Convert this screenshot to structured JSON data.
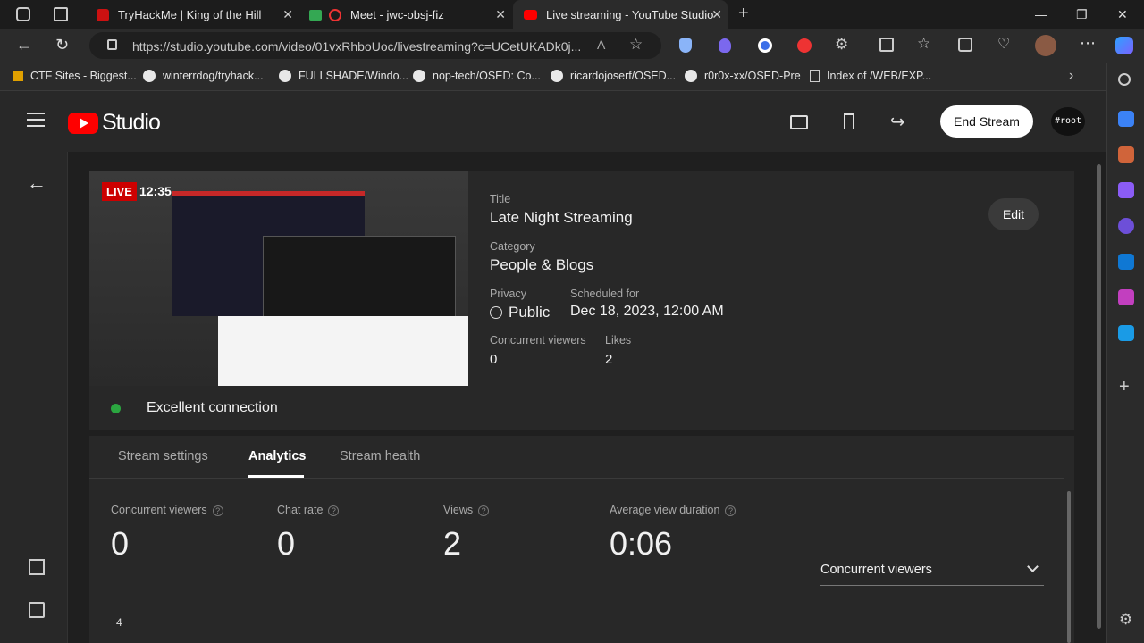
{
  "browser": {
    "tabs": [
      {
        "title": "TryHackMe | King of the Hill",
        "active": false
      },
      {
        "title": "Meet - jwc-obsj-fiz",
        "active": false
      },
      {
        "title": "Live streaming - YouTube Studio",
        "active": true
      }
    ],
    "url": "https://studio.youtube.com/video/01vxRhboUoc/livestreaming?c=UCetUKADk0j...",
    "bookmarks": [
      "CTF Sites - Biggest...",
      "winterrdog/tryhack...",
      "FULLSHADE/Windo...",
      "nop-tech/OSED: Co...",
      "ricardojoserf/OSED...",
      "r0r0x-xx/OSED-Pre",
      "Index of /WEB/EXP..."
    ]
  },
  "studio": {
    "logo_text": "Studio",
    "end_stream_label": "End Stream",
    "avatar_text": "#root",
    "live_badge": "LIVE",
    "live_time": "12:35",
    "connection_status": "Excellent connection",
    "details": {
      "title_label": "Title",
      "title": "Late Night Streaming",
      "category_label": "Category",
      "category": "People & Blogs",
      "privacy_label": "Privacy",
      "privacy": "Public",
      "scheduled_label": "Scheduled for",
      "scheduled": "Dec 18, 2023, 12:00 AM",
      "viewers_label": "Concurrent viewers",
      "viewers": "0",
      "likes_label": "Likes",
      "likes": "2",
      "edit_label": "Edit"
    },
    "tabs": [
      "Stream settings",
      "Analytics",
      "Stream health"
    ],
    "active_tab": "Analytics",
    "stats": [
      {
        "label": "Concurrent viewers",
        "value": "0"
      },
      {
        "label": "Chat rate",
        "value": "0"
      },
      {
        "label": "Views",
        "value": "2"
      },
      {
        "label": "Average view duration",
        "value": "0:06"
      }
    ],
    "metric_dropdown": "Concurrent viewers",
    "chart_y_tick": "4"
  },
  "colors": {
    "accent_red": "#ff0000",
    "status_green": "#2ba640"
  }
}
